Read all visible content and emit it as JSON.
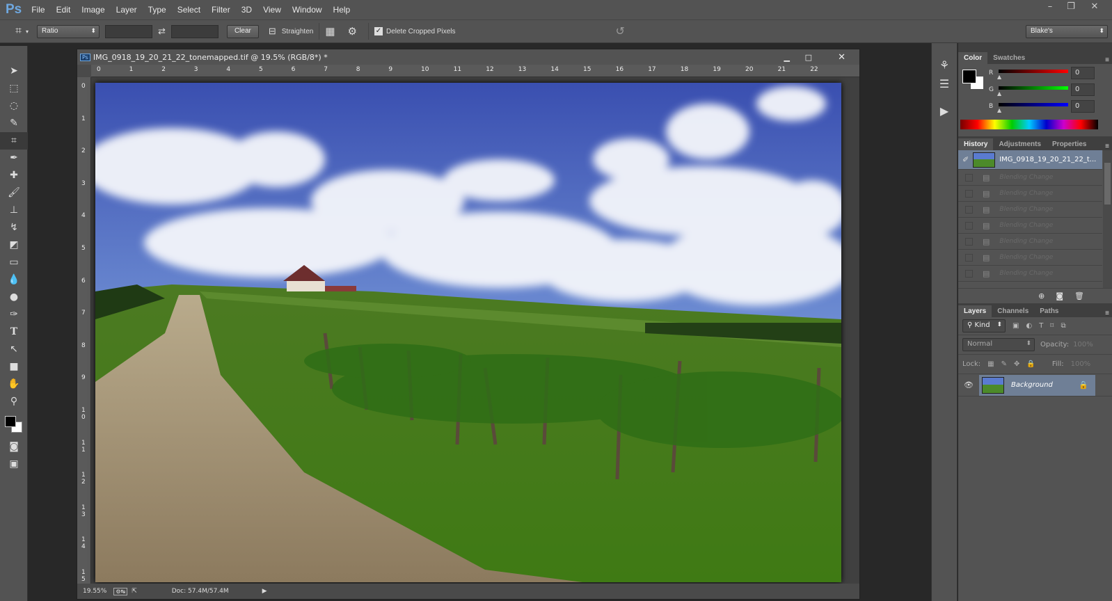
{
  "app": {
    "logo": "Ps",
    "menu": [
      "File",
      "Edit",
      "Image",
      "Layer",
      "Type",
      "Select",
      "Filter",
      "3D",
      "View",
      "Window",
      "Help"
    ],
    "window_controls": [
      "–",
      "❐",
      "✕"
    ]
  },
  "options": {
    "ratio": "Ratio",
    "clear": "Clear",
    "straighten": "Straighten",
    "delete_cropped": "Delete Cropped Pixels",
    "delete_cropped_checked": true,
    "workspace": "Blake's"
  },
  "document": {
    "title": "IMG_0918_19_20_21_22_tonemapped.tif @ 19.5% (RGB/8*) *",
    "ruler_top": [
      "0",
      "1",
      "2",
      "3",
      "4",
      "5",
      "6",
      "7",
      "8",
      "9",
      "10",
      "11",
      "12",
      "13",
      "14",
      "15",
      "16",
      "17",
      "18",
      "19",
      "20",
      "21",
      "22"
    ],
    "ruler_left": [
      "0",
      "1",
      "2",
      "3",
      "4",
      "5",
      "6",
      "7",
      "8",
      "9",
      "10",
      "11",
      "12",
      "13",
      "14",
      "15"
    ],
    "zoom": "19.55%",
    "doc_size": "Doc: 57.4M/57.4M"
  },
  "color_panel": {
    "tabs": [
      "Color",
      "Swatches"
    ],
    "channels": [
      {
        "label": "R",
        "value": "0",
        "color": "#ff0000"
      },
      {
        "label": "G",
        "value": "0",
        "color": "#00ff00"
      },
      {
        "label": "B",
        "value": "0",
        "color": "#0000ff"
      }
    ]
  },
  "history_panel": {
    "tabs": [
      "History",
      "Adjustments",
      "Properties"
    ],
    "snapshot": "IMG_0918_19_20_21_22_t...",
    "items": [
      "Blending Change",
      "Blending Change",
      "Blending Change",
      "Blending Change",
      "Blending Change",
      "Blending Change",
      "Blending Change"
    ]
  },
  "layers_panel": {
    "tabs": [
      "Layers",
      "Channels",
      "Paths"
    ],
    "filter": "Kind",
    "blend_mode": "Normal",
    "opacity_label": "Opacity:",
    "opacity": "100%",
    "lock_label": "Lock:",
    "fill_label": "Fill:",
    "fill": "100%",
    "layers": [
      {
        "name": "Background",
        "locked": true,
        "visible": true
      }
    ]
  }
}
